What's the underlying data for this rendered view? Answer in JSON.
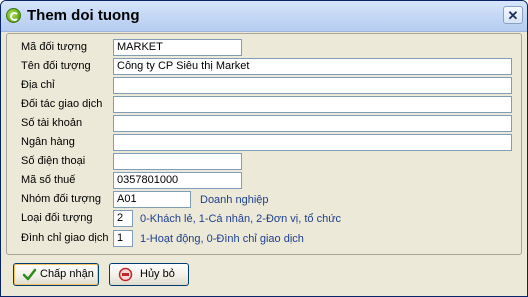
{
  "window": {
    "title": "Them doi tuong"
  },
  "form": {
    "ma_doi_tuong": {
      "label": "Mã đối tượng",
      "value": "MARKET"
    },
    "ten_doi_tuong": {
      "label": "Tên đối tượng",
      "value": "Công ty CP Siêu thị Market"
    },
    "dia_chi": {
      "label": "Địa chỉ",
      "value": ""
    },
    "doi_tac_giao_dich": {
      "label": "Đối tác giao dịch",
      "value": ""
    },
    "so_tai_khoan": {
      "label": "Số tài khoản",
      "value": ""
    },
    "ngan_hang": {
      "label": "Ngân hàng",
      "value": ""
    },
    "so_dien_thoai": {
      "label": "Số điện thoại",
      "value": ""
    },
    "ma_so_thue": {
      "label": "Mã số thuế",
      "value": "0357801000"
    },
    "nhom_doi_tuong": {
      "label": "Nhóm đối tượng",
      "value": "A01",
      "description": "Doanh nghiệp"
    },
    "loai_doi_tuong": {
      "label": "Loại đối tượng",
      "value": "2",
      "hint": "0-Khách lẻ, 1-Cá nhân, 2-Đơn vị, tổ chức"
    },
    "dinh_chi_giao_dich": {
      "label": "Đình chỉ giao dịch",
      "value": "1",
      "hint": "1-Hoạt động, 0-Đình chỉ giao dịch"
    }
  },
  "buttons": {
    "ok_label": "Chấp nhận",
    "cancel_label": "Hủy bỏ"
  },
  "icons": {
    "app": "app-logo-icon",
    "close": "close-icon",
    "ok": "checkmark-icon",
    "cancel": "cancel-icon"
  },
  "colors": {
    "hint_text": "#1f3f8f",
    "field_border": "#7f9db9",
    "ok_icon": "#2e8b1f",
    "cancel_icon": "#c0282b"
  }
}
